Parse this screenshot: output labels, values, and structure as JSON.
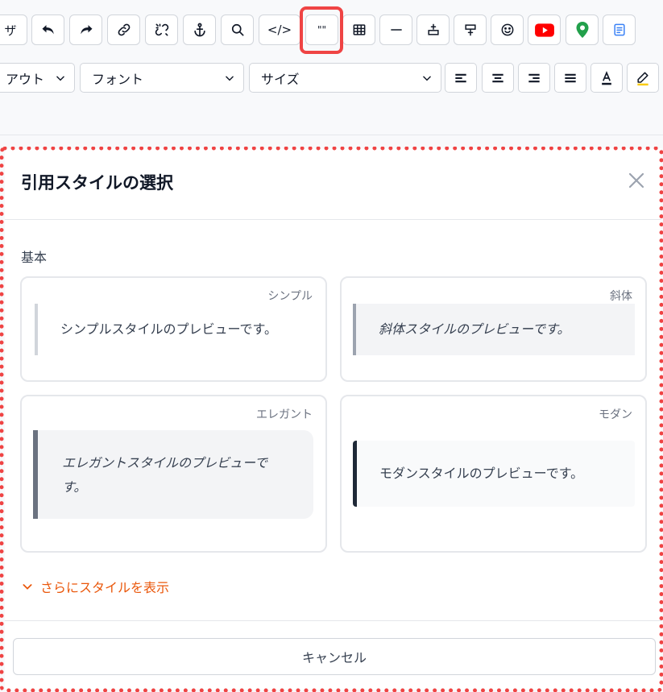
{
  "toolbar": {
    "row1": {
      "partial_button_label": "ザ",
      "code_button_label": "</>",
      "quote_button_label": "\"\""
    },
    "row2": {
      "layout_select_value": "アウト",
      "font_select_value": "フォント",
      "size_select_value": "サイズ"
    },
    "colors": {
      "highlight_frame": "#ef4444",
      "youtube_red": "#ff0000",
      "map_pin_green": "#22a04b"
    }
  },
  "dialog": {
    "title": "引用スタイルの選択",
    "section_label": "基本",
    "cards": [
      {
        "tag": "シンプル",
        "preview": "シンプルスタイルのプレビューです。"
      },
      {
        "tag": "斜体",
        "preview": "斜体スタイルのプレビューです。"
      },
      {
        "tag": "エレガント",
        "preview": "エレガントスタイルのプレビューです。"
      },
      {
        "tag": "モダン",
        "preview": "モダンスタイルのプレビューです。"
      }
    ],
    "more_styles_label": "さらにスタイルを表示",
    "cancel_label": "キャンセル",
    "accent_color": "#ea580c"
  }
}
